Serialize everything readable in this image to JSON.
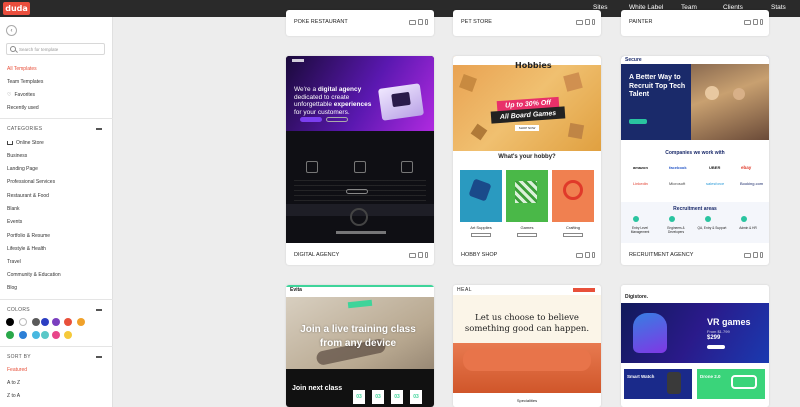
{
  "topbar": {
    "logo": "duda",
    "nav": [
      "Sites",
      "White Label",
      "Team",
      "Clients",
      "Stats"
    ]
  },
  "sidebar": {
    "search_placeholder": "Search for template",
    "main_items": [
      "All Templates",
      "Team Templates",
      "Favorites",
      "Recently used"
    ],
    "categories_heading": "CATEGORIES",
    "categories": [
      "Online Store",
      "Business",
      "Landing Page",
      "Professional Services",
      "Restaurant & Food",
      "Blank",
      "Events",
      "Portfolio & Resume",
      "Lifestyle & Health",
      "Travel",
      "Community & Education",
      "Blog"
    ],
    "colors_heading": "COLORS",
    "colors": [
      "#000000",
      "#ffffff",
      "#5a5a5a",
      "#2c3ec2",
      "#7a3fbf",
      "#e8503a",
      "#f0a12a",
      "#2aa84a",
      "#2c7fd6",
      "#48b8e0",
      "#5ac8c8",
      "#e8468a",
      "#f5c93a"
    ],
    "sort_heading": "SORT BY",
    "sort_options": [
      "Featured",
      "A to Z",
      "Z to A"
    ]
  },
  "cards": {
    "top_row": [
      "POKE RESTAURANT",
      "PET STORE",
      "PAINTER"
    ],
    "mid_row": [
      "DIGITAL AGENCY",
      "HOBBY SHOP",
      "RECRUITMENT AGENCY"
    ]
  },
  "digital": {
    "headline_1": "We're a ",
    "headline_bold": "digital agency",
    "headline_2": " dedicated to create unforgettable ",
    "headline_bold2": "experiences",
    "headline_3": " for your customers."
  },
  "hobby": {
    "brand": "Hobbies",
    "promo_1": "Up to 30% Off",
    "promo_2": "All Board Games",
    "shop_btn": "SHOP NOW",
    "section_title": "What's your hobby?",
    "items": [
      "Art Supplies",
      "Games",
      "Crafting"
    ]
  },
  "recruit": {
    "brand": "Secure",
    "headline": "A Better Way to Recruit Top Tech Talent",
    "companies_title": "Companies we work with",
    "companies": [
      "amazon",
      "facebook",
      "UBER",
      "ebay",
      "Linkedin",
      "Microsoft",
      "salesforce",
      "Booking.com"
    ],
    "areas_title": "Recruitment areas",
    "areas": [
      "Entry Level Management",
      "Engineers & Developers",
      "QA, Entry & Support",
      "Admin & HR"
    ]
  },
  "fitness": {
    "brand": "Evita",
    "headline": "Join a live training class from any device",
    "next_class": "Join next class",
    "countdown": [
      "03",
      "03",
      "03",
      "03"
    ]
  },
  "heal": {
    "brand": "HEAL",
    "headline": "Let us choose to believe something good can happen.",
    "footer": "Specialities"
  },
  "digistore": {
    "brand": "Digistore.",
    "headline": "VR games",
    "sub": "From $1.799",
    "price": "$299",
    "promo_1": "Smart Watch",
    "promo_2": "Drone 2.0"
  }
}
